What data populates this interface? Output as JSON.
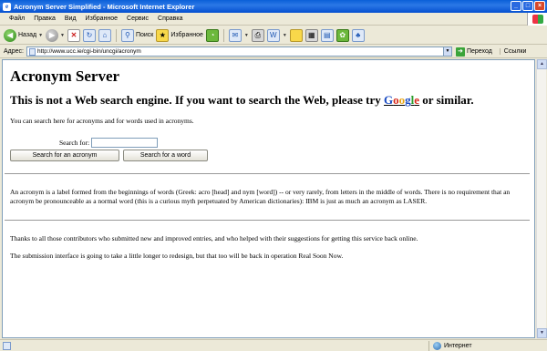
{
  "window": {
    "title": "Acronym Server Simplified - Microsoft Internet Explorer",
    "minimize": "_",
    "maximize": "□",
    "close": "×"
  },
  "menu": [
    "Файл",
    "Правка",
    "Вид",
    "Избранное",
    "Сервис",
    "Справка"
  ],
  "toolbar": {
    "back_label": "Назад",
    "search_label": "Поиск",
    "favorites_label": "Избранное"
  },
  "address": {
    "label": "Адрес:",
    "url": "http://www.ucc.ie/cgi-bin/uncgi/acronym",
    "go_label": "Переход",
    "links_label": "Ссылки"
  },
  "page": {
    "heading": "Acronym Server",
    "subheading_pre": "This is not a Web search engine. If you want to search the Web, please try ",
    "google_letters": [
      "G",
      "o",
      "o",
      "g",
      "l",
      "e"
    ],
    "subheading_post": " or similar.",
    "intro": "You can search here for acronyms and for words used in acronyms.",
    "search_label": "Search for:",
    "search_value": "",
    "btn_acronym": "Search for an acronym",
    "btn_word": "Search for a word",
    "definition": "An acronym is a label formed from the beginnings of words (Greek: acro [head] and nym [word]) -- or very rarely, from letters in the middle of words. There is no requirement that an acronym be pronounceable as a normal word (this is a curious myth perpetuated by American dictionaries): IBM is just as much an acronym as LASER.",
    "thanks": "Thanks to all those contributors who submitted new and improved entries, and who helped with their suggestions for getting this service back online.",
    "submission": "The submission interface is going to take a little longer to redesign, but that too will be back in operation Real Soon Now."
  },
  "status": {
    "zone": "Интернет"
  },
  "colors": {
    "titlebar": "#0a5fd8",
    "chrome": "#ece9d8"
  }
}
